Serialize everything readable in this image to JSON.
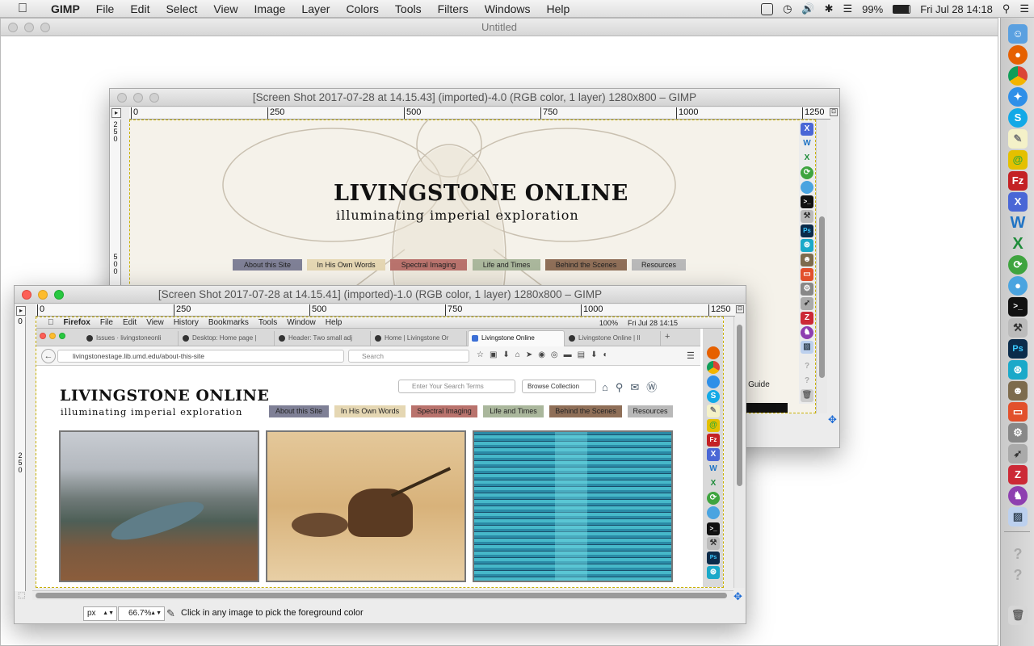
{
  "menubar": {
    "apple": "",
    "items": [
      "GIMP",
      "File",
      "Edit",
      "Select",
      "View",
      "Image",
      "Layer",
      "Colors",
      "Tools",
      "Filters",
      "Windows",
      "Help"
    ],
    "battery": "99%",
    "datetime": "Fri Jul 28  14:18"
  },
  "untitled_window": {
    "title": "Untitled"
  },
  "gimp_back": {
    "title": "[Screen Shot 2017-07-28 at 14.15.43] (imported)-4.0 (RGB color, 1 layer) 1280x800 – GIMP",
    "ruler": [
      "0",
      "250",
      "500",
      "750",
      "1000",
      "1250"
    ],
    "vruler_top": "2\n5\n0",
    "vruler_bottom": "5\n0\n0",
    "site_title": "LIVINGSTONE ONLINE",
    "site_subtitle": "illuminating imperial exploration",
    "nav": [
      "About this Site",
      "In His Own Words",
      "Spectral Imaging",
      "Life and Times",
      "Behind the Scenes",
      "Resources"
    ],
    "peek_text": "te Guide"
  },
  "gimp_front": {
    "title": "[Screen Shot 2017-07-28 at 14.15.41] (imported)-1.0 (RGB color, 1 layer) 1280x800 – GIMP",
    "ruler": [
      "0",
      "250",
      "500",
      "750",
      "1000",
      "1250"
    ],
    "vruler": "2\n5\n0",
    "unit": "px",
    "zoom": "66.7%",
    "status_message": "Click in any image to pick the foreground color"
  },
  "firefox": {
    "menu": [
      "Firefox",
      "File",
      "Edit",
      "View",
      "History",
      "Bookmarks",
      "Tools",
      "Window",
      "Help"
    ],
    "battery": "100%",
    "datetime": "Fri Jul 28  14:15",
    "tabs": [
      "Issues · livingstoneonli",
      "Desktop: Home page |",
      "Header: Two small adj",
      "Home | Livingstone Or",
      "Livingstone Online",
      "Livingstone Online | Il"
    ],
    "url": "livingstonestage.lib.umd.edu/about-this-site",
    "search_placeholder": "Search"
  },
  "site": {
    "title": "LIVINGSTONE ONLINE",
    "subtitle": "illuminating imperial exploration",
    "search_placeholder": "Enter Your Search Terms",
    "browse_label": "Browse Collection",
    "nav": [
      "About this Site",
      "In His Own Words",
      "Spectral Imaging",
      "Life and Times",
      "Behind the Scenes",
      "Resources"
    ]
  },
  "colors": {
    "nav_about": "#7f8096",
    "nav_words": "#e5d7b3",
    "nav_spectral": "#b9736d",
    "nav_life": "#aab79c",
    "nav_behind": "#8f6f58",
    "nav_resources": "#b9b9b9"
  },
  "dock_icons": [
    "finder-icon",
    "firefox-icon",
    "chrome-icon",
    "safari-icon",
    "skype-icon",
    "notes-icon",
    "growl-icon",
    "filezilla-icon",
    "x-app-icon",
    "word-icon",
    "excel-icon",
    "sync-icon",
    "chrome-canary-icon",
    "terminal-icon",
    "tool-icon",
    "photoshop-icon",
    "prefs-icon",
    "gimp-icon",
    "screen-sharing-icon",
    "settings-icon",
    "rocket-icon",
    "zotero-icon",
    "github-icon",
    "preview-icon",
    "help-icon",
    "help-icon",
    "trash-icon"
  ]
}
